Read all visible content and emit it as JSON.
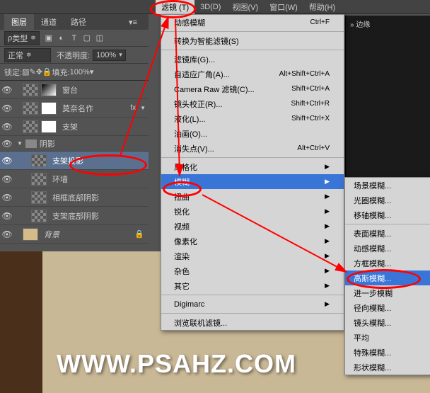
{
  "menubar": {
    "filter": "滤镜 (T)",
    "3d": "3D(D)",
    "view": "视图(V)",
    "window": "窗口(W)",
    "help": "帮助(H)"
  },
  "panel": {
    "tab_layers": "图层",
    "tab_channels": "通道",
    "tab_paths": "路径"
  },
  "row1": {
    "type": "类型",
    "type_icons": "▣ ◐ T ▢ ◫"
  },
  "row2": {
    "blend": "正常",
    "opacity_label": "不透明度:",
    "opacity_val": "100%"
  },
  "row3": {
    "lock": "锁定:",
    "fill_label": "填充:",
    "fill_val": "100%"
  },
  "layers": [
    {
      "name": "窗台",
      "type": "masked"
    },
    {
      "name": "莫奈名作",
      "type": "masked",
      "fx": "fx"
    },
    {
      "name": "支架",
      "type": "masked"
    },
    {
      "name": "阴影",
      "type": "folder"
    },
    {
      "name": "支架投影",
      "type": "checker",
      "selected": true
    },
    {
      "name": "环墙",
      "type": "checker"
    },
    {
      "name": "相框底部阴影",
      "type": "checker"
    },
    {
      "name": "支架底部阴影",
      "type": "checker"
    },
    {
      "name": "背景",
      "type": "tan"
    }
  ],
  "filter_menu": {
    "motion_blur": "动感模糊",
    "motion_blur_key": "Ctrl+F",
    "to_smart": "转换为智能滤镜(S)",
    "gallery": "滤镜库(G)...",
    "adaptive": "自适应广角(A)...",
    "adaptive_key": "Alt+Shift+Ctrl+A",
    "camera": "Camera Raw 滤镜(C)...",
    "camera_key": "Shift+Ctrl+A",
    "lens": "镜头校正(R)...",
    "lens_key": "Shift+Ctrl+R",
    "liquify": "液化(L)...",
    "liquify_key": "Shift+Ctrl+X",
    "oil": "油画(O)...",
    "vanish": "消失点(V)...",
    "vanish_key": "Alt+Ctrl+V",
    "stylize": "风格化",
    "blur": "模糊",
    "distort": "扭曲",
    "sharpen": "锐化",
    "video": "视频",
    "pixelate": "像素化",
    "render": "渲染",
    "noise": "杂色",
    "other": "其它",
    "digimarc": "Digimarc",
    "online": "浏览联机滤镜..."
  },
  "blur_menu": {
    "field": "场景模糊...",
    "iris": "光圈模糊...",
    "tilt": "移轴模糊...",
    "surface": "表面模糊...",
    "motion": "动感模糊...",
    "box": "方框模糊...",
    "gaussian": "高斯模糊...",
    "further": "进一步模糊",
    "radial": "径向模糊...",
    "lens": "镜头模糊...",
    "average": "平均",
    "special": "特殊模糊...",
    "shape": "形状模糊..."
  },
  "dark_tab": "» 边缘",
  "watermark": "WWW.PSAHZ.COM"
}
